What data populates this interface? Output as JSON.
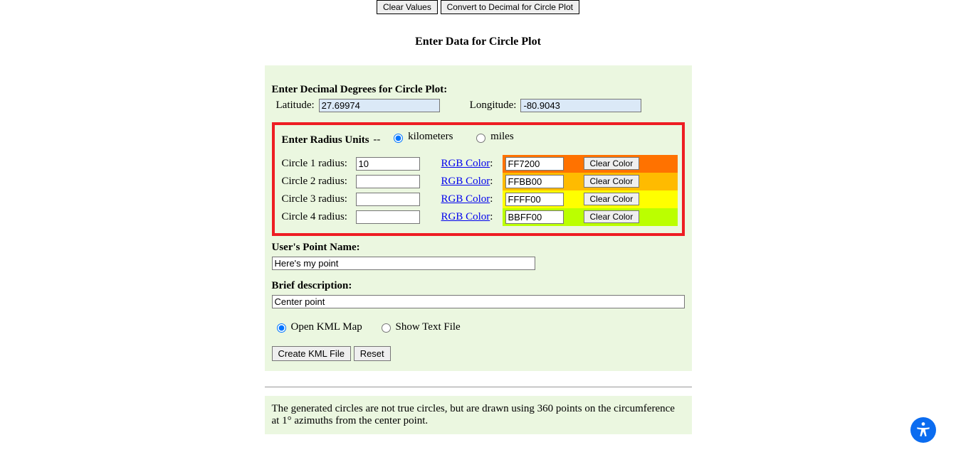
{
  "top_buttons": {
    "clear_values": "Clear Values",
    "convert_decimal": "Convert to Decimal for Circle Plot"
  },
  "main_heading": "Enter Data for Circle Plot",
  "decimal_section": {
    "title": "Enter Decimal Degrees for Circle Plot:",
    "latitude_label": "Latitude:",
    "latitude_value": "27.69974",
    "longitude_label": "Longitude:",
    "longitude_value": "-80.9043"
  },
  "radius_section": {
    "title": "Enter Radius Units",
    "dashes": " -- ",
    "units": {
      "km_label": "kilometers",
      "miles_label": "miles",
      "selected": "km"
    },
    "rgb_link_text": "RGB Color",
    "clear_color_label": "Clear Color",
    "circles": [
      {
        "label": "Circle 1 radius:",
        "radius": "10",
        "color": "FF7200",
        "bg": "#FF7200"
      },
      {
        "label": "Circle 2 radius:",
        "radius": "",
        "color": "FFBB00",
        "bg": "#FFBB00"
      },
      {
        "label": "Circle 3 radius:",
        "radius": "",
        "color": "FFFF00",
        "bg": "#FFFF00"
      },
      {
        "label": "Circle 4 radius:",
        "radius": "",
        "color": "BBFF00",
        "bg": "#BBFF00"
      }
    ]
  },
  "point_name": {
    "title": "User's Point Name:",
    "value": "Here's my point"
  },
  "description": {
    "title": "Brief description:",
    "value": "Center point"
  },
  "output": {
    "open_kml_label": "Open KML Map",
    "show_text_label": "Show Text File",
    "selected": "open_kml"
  },
  "bottom_buttons": {
    "create": "Create KML File",
    "reset": "Reset"
  },
  "footer_note": "The generated circles are not true circles, but are drawn using 360 points on the circumference at 1° azimuths from the center point."
}
